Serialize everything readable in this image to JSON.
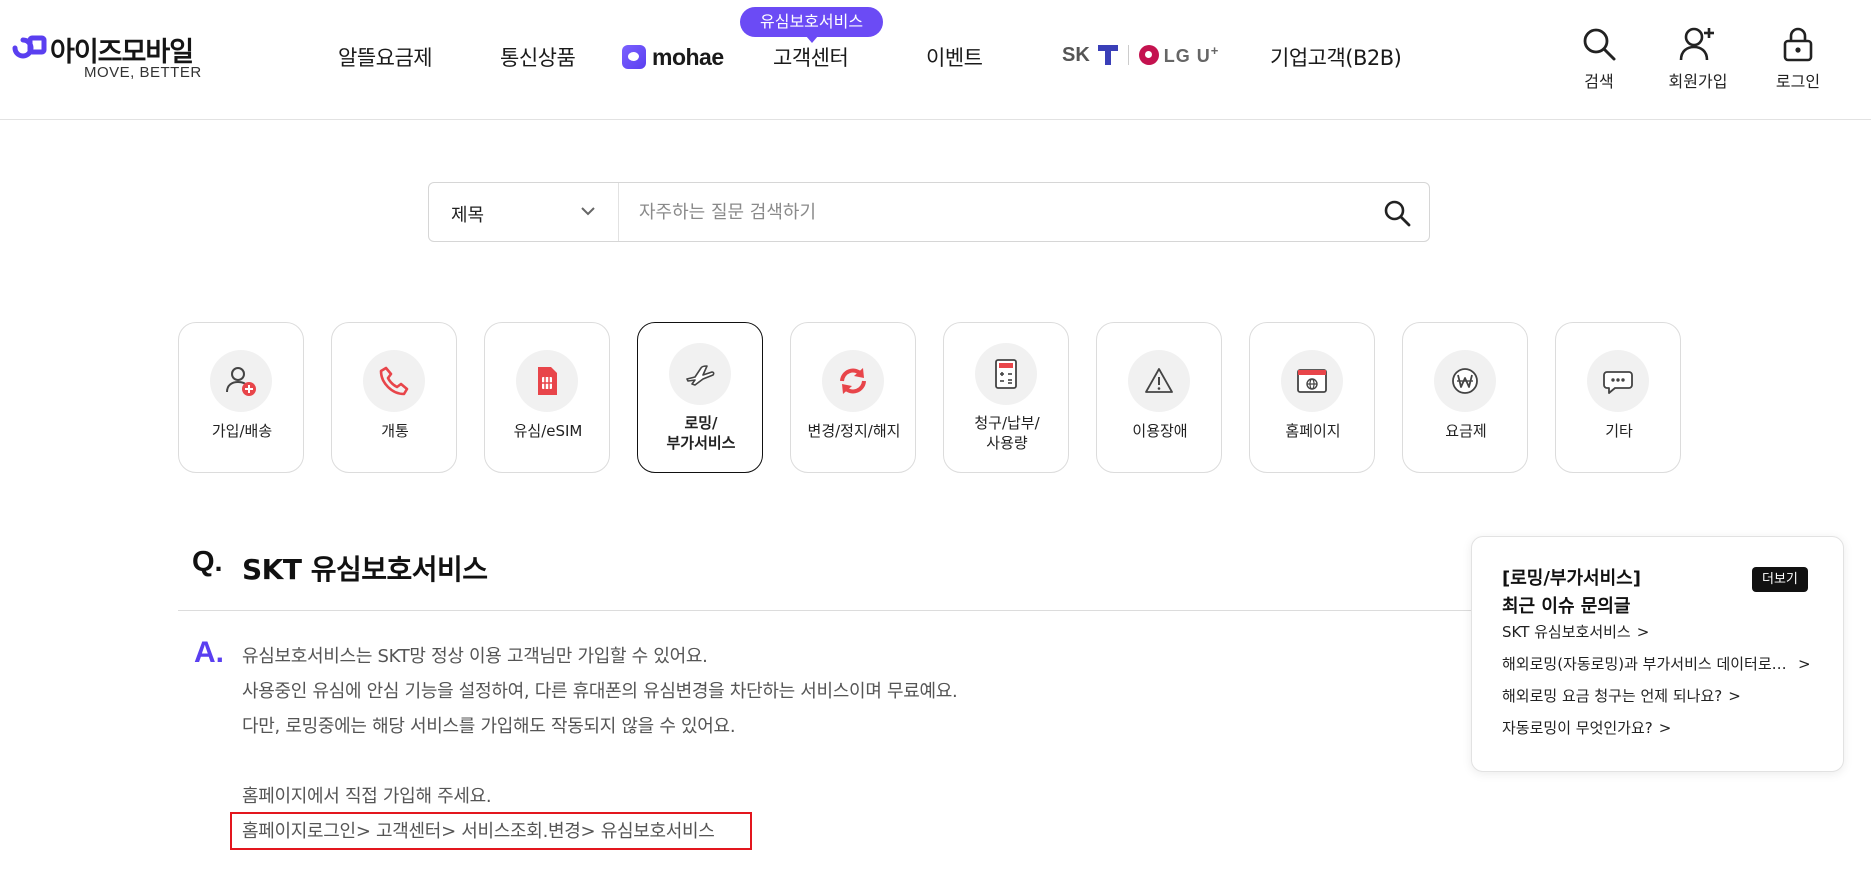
{
  "brand": {
    "name": "아이즈모바일",
    "tagline": "MOVE, BETTER"
  },
  "nav": {
    "items": [
      "알뜰요금제",
      "통신상품",
      "고객센터",
      "이벤트",
      "기업고객(B2B)"
    ],
    "mohae": "mohae",
    "badge": "유심보호서비스",
    "carrier_skt": "SK",
    "carrier_lgu": "LG U",
    "carrier_lgu_plus": "+"
  },
  "util": {
    "search": "검색",
    "signup": "회원가입",
    "login": "로그인"
  },
  "search": {
    "select_value": "제목",
    "placeholder": "자주하는 질문 검색하기"
  },
  "categories": [
    {
      "label": "가입/배송",
      "icon": "user-add-icon"
    },
    {
      "label": "개통",
      "icon": "phone-icon"
    },
    {
      "label": "유심/eSIM",
      "icon": "sim-icon"
    },
    {
      "label_1": "로밍/",
      "label_2": "부가서비스",
      "icon": "airplane-icon",
      "active": true
    },
    {
      "label": "변경/정지/해지",
      "icon": "refresh-icon"
    },
    {
      "label_1": "청구/납부/",
      "label_2": "사용량",
      "icon": "calculator-icon"
    },
    {
      "label": "이용장애",
      "icon": "warning-icon"
    },
    {
      "label": "홈페이지",
      "icon": "browser-icon"
    },
    {
      "label": "요금제",
      "icon": "won-icon"
    },
    {
      "label": "기타",
      "icon": "chat-icon"
    }
  ],
  "qa": {
    "q_mark": "Q.",
    "question": "SKT 유심보호서비스",
    "a_mark": "A.",
    "lines": [
      "유심보호서비스는 SKT망 정상 이용 고객님만 가입할 수 있어요.",
      "사용중인 유심에 안심 기능을 설정하여, 다른 휴대폰의 유심변경을 차단하는 서비스이며 무료예요.",
      "다만, 로밍중에는 해당 서비스를 가입해도 작동되지 않을 수 있어요.",
      "홈페이지에서 직접 가입해 주세요.",
      "홈페이지로그인> 고객센터> 서비스조회.변경> 유심보호서비스"
    ]
  },
  "panel": {
    "title_1": "[로밍/부가서비스]",
    "title_2": "최근 이슈 문의글",
    "more": "더보기",
    "links": [
      "SKT 유심보호서비스",
      "해외로밍(자동로밍)과 부가서비스 데이터로밍 차단은 어떻게 하나요?",
      "해외로밍 요금 청구는 언제 되나요?",
      "자동로밍이 무엇인가요?"
    ]
  },
  "colors": {
    "accent": "#6b4bf5",
    "highlight_border": "#e3161e",
    "phone_icon": "#e8454a"
  }
}
